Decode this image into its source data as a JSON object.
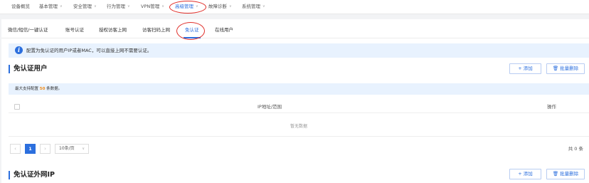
{
  "topnav": {
    "items": [
      {
        "label": "设备概览",
        "has_menu": false
      },
      {
        "label": "基本管理",
        "has_menu": true
      },
      {
        "label": "安全管理",
        "has_menu": true
      },
      {
        "label": "行为管理",
        "has_menu": true
      },
      {
        "label": "VPN管理",
        "has_menu": true
      },
      {
        "label": "高级管理",
        "has_menu": true,
        "active": true
      },
      {
        "label": "故障诊断",
        "has_menu": true
      },
      {
        "label": "系统管理",
        "has_menu": true
      }
    ],
    "chevron_icon": "chevron-down-icon"
  },
  "subtabs": [
    {
      "label": "微信/短信/一键认证"
    },
    {
      "label": "账号认证"
    },
    {
      "label": "授权访客上网"
    },
    {
      "label": "访客扫码上网"
    },
    {
      "label": "免认证",
      "active": true
    },
    {
      "label": "在线用户"
    }
  ],
  "notice": {
    "icon": "info-icon",
    "icon_glyph": "i",
    "text": "配置为免认证的用户IP或者MAC，可以直接上网不需要认证。"
  },
  "section1": {
    "title": "免认证用户",
    "add_label": "+ 添加",
    "batch_delete_label": "批量删除",
    "delete_icon": "trash-icon",
    "limit": {
      "prefix": "最大支持配置",
      "count": "50",
      "suffix": "条数据。"
    },
    "table": {
      "columns": [
        "IP地址/范围",
        "操作"
      ],
      "empty_text": "暂无数据"
    },
    "pagination": {
      "prev": "‹",
      "next": "›",
      "current_page": "1",
      "page_size": "10条/页",
      "total": "共 0 条"
    }
  },
  "section2": {
    "title": "免认证外网IP",
    "add_label": "+ 添加",
    "batch_delete_label": "批量删除"
  },
  "colors": {
    "accent": "#2c6fde",
    "highlight_circle": "#e0302b",
    "limit_number": "#f08c1a",
    "notice_bg": "#e8f2fe"
  }
}
